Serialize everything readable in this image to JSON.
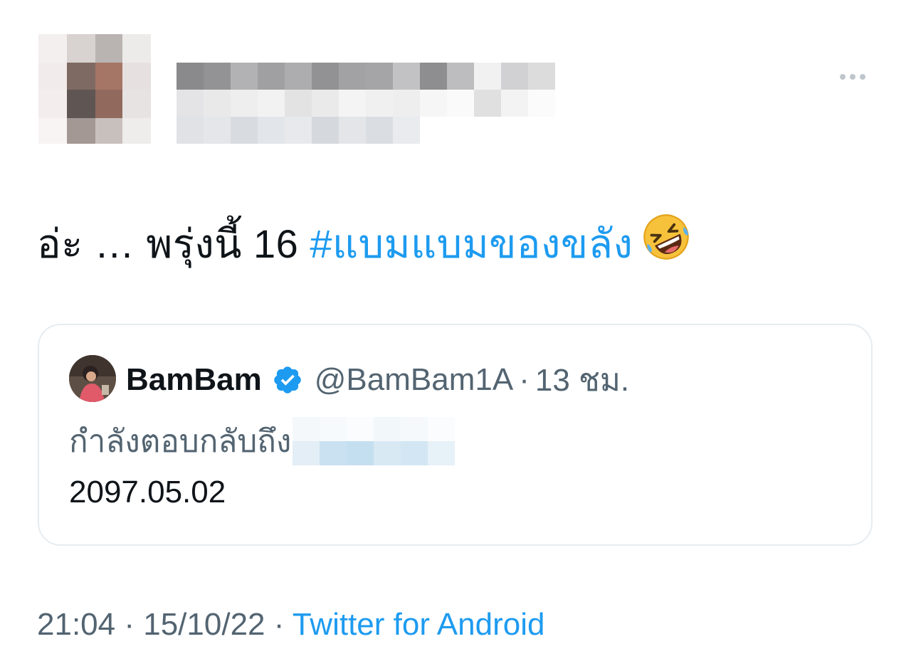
{
  "tweet": {
    "text_prefix": "อ่ะ … พรุ่งนี้ 16 ",
    "hashtag": "#แบมแบมของขลัง",
    "emoji": "rolling-on-floor-laughing-emoji"
  },
  "header": {
    "more_icon": "more-horizontal-icon",
    "author_obscured": true
  },
  "quote": {
    "name": "BamBam",
    "verified_icon": "verified-badge-icon",
    "handle": "@BamBam1A",
    "separator": "·",
    "time": "13 ชม.",
    "replying_to_label": "กำลังตอบกลับถึง",
    "body": "2097.05.02"
  },
  "meta": {
    "time": "21:04",
    "separator": "·",
    "date": "15/10/22",
    "source": "Twitter for Android"
  },
  "colors": {
    "accent": "#1d9bf0",
    "secondary_text": "#536471",
    "primary_text": "#0f1419",
    "border": "#e6ecf0"
  }
}
